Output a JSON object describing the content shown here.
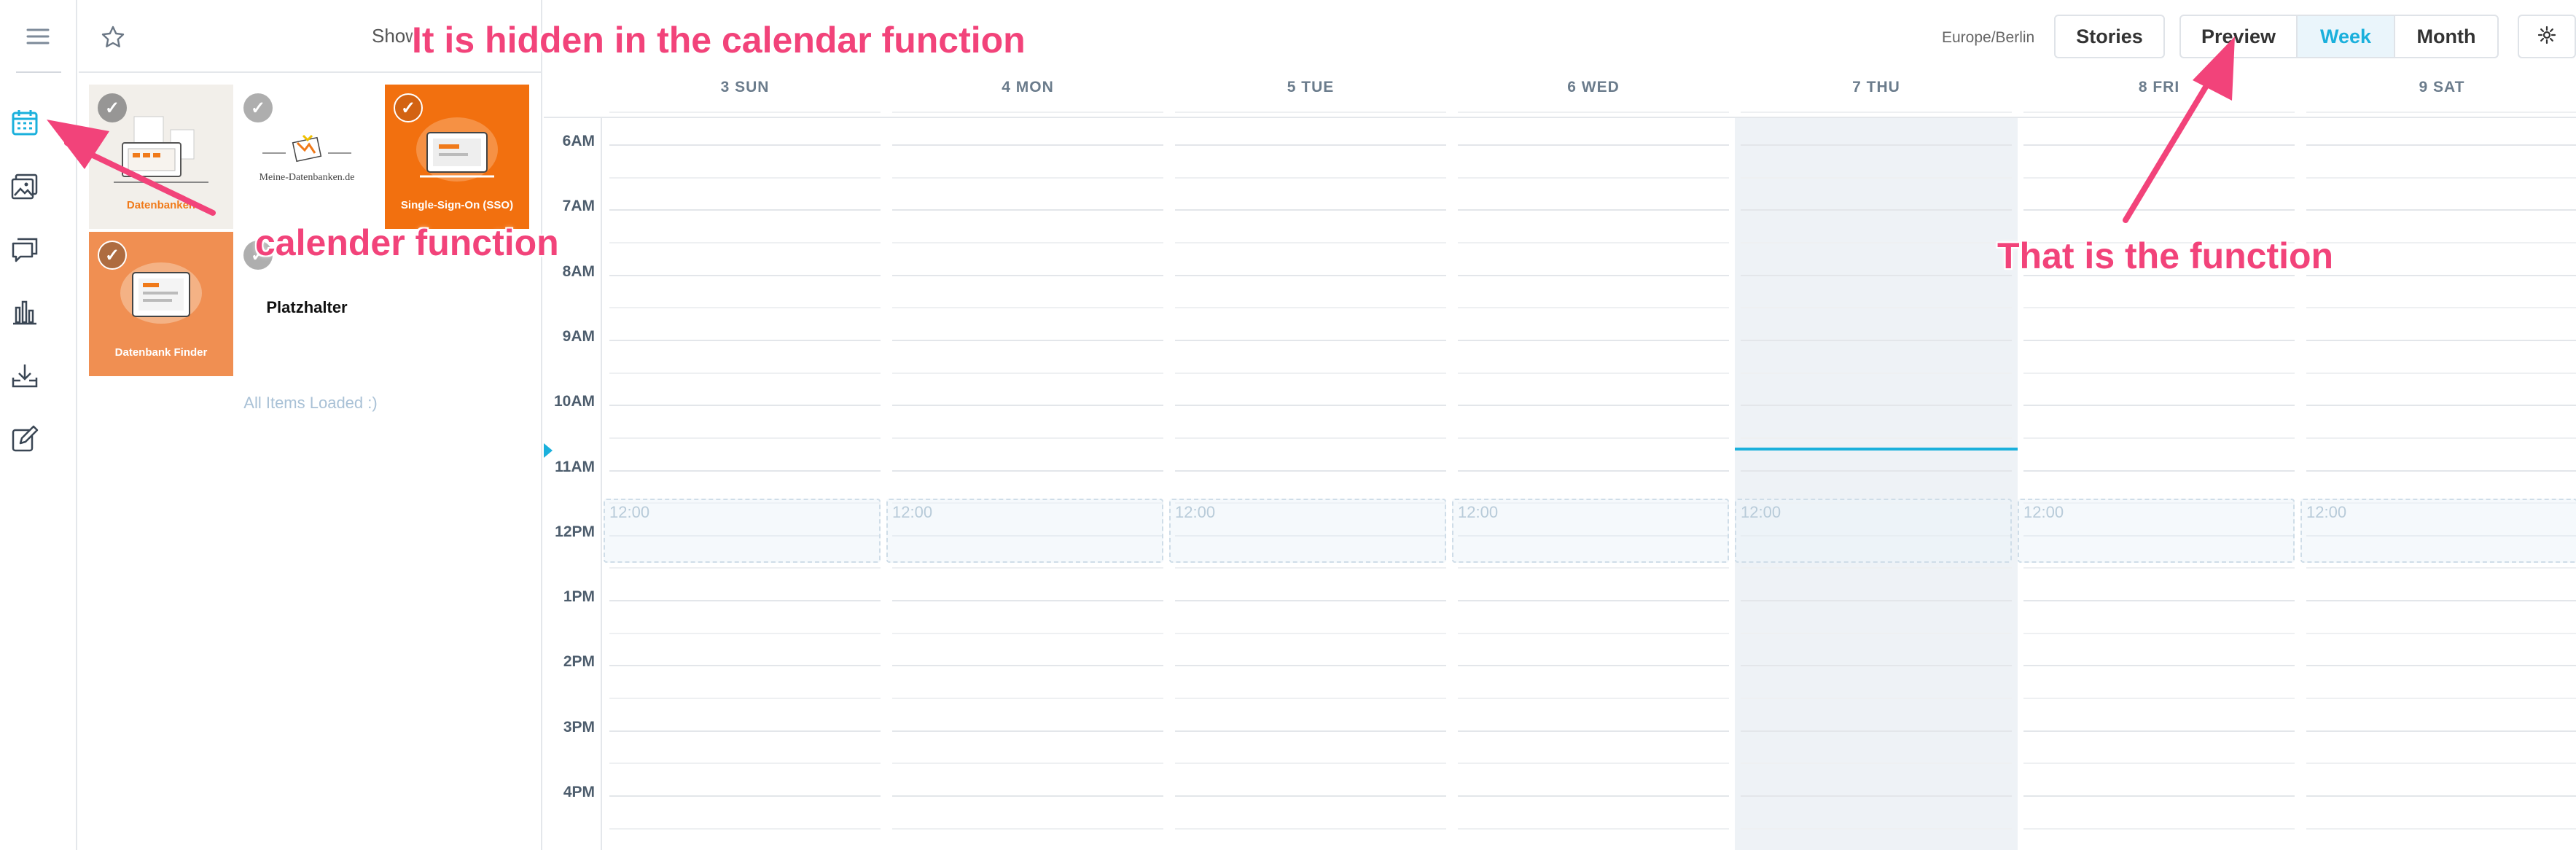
{
  "library": {
    "show_label": "Show",
    "show_label2": "(",
    "tiles": [
      {
        "label": "Datenbanken",
        "checked": true
      },
      {
        "label": "Meine-Datenbanken.de",
        "checked": true
      },
      {
        "label": "Single-Sign-On (SSO)",
        "checked": true
      },
      {
        "label": "Datenbank Finder",
        "checked": true
      },
      {
        "label": "Platzhalter",
        "checked": true
      }
    ],
    "loaded_text": "All Items Loaded :)"
  },
  "toolbar": {
    "timezone": "Europe/Berlin",
    "stories": "Stories",
    "preview": "Preview",
    "week": "Week",
    "month": "Month"
  },
  "days": [
    "3 SUN",
    "4 MON",
    "5 TUE",
    "6 WED",
    "7 THU",
    "8 FRI",
    "9 SAT"
  ],
  "hours": [
    "6AM",
    "7AM",
    "8AM",
    "9AM",
    "10AM",
    "11AM",
    "12PM",
    "1PM",
    "2PM",
    "3PM",
    "4PM"
  ],
  "slot_label": "12:00",
  "annotations": {
    "top": "It is hidden in the calendar function",
    "left": "calender function",
    "right": "That is the function"
  },
  "colors": {
    "accent": "#1ab0dc",
    "annotation": "#f2437a",
    "orange": "#f07a1a",
    "today_bg": "#eef2f6"
  }
}
